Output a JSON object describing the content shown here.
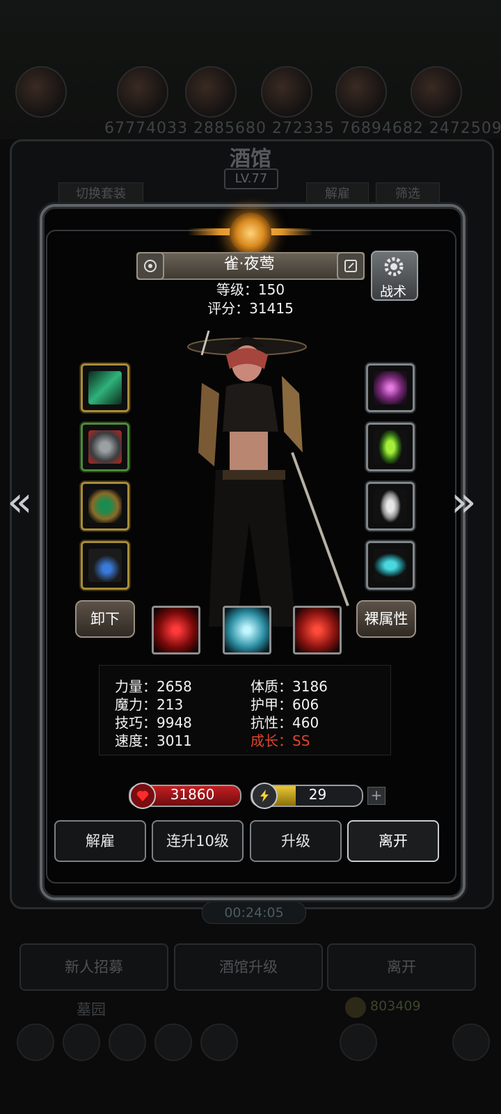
{
  "background": {
    "numbers_text": "67774033 2885680  272335  76894682 2472509",
    "title": "酒馆",
    "level": "LV.77",
    "tab_switch_set": "切换套装",
    "tab_dismiss": "解雇",
    "tab_filter": "筛选",
    "timer": "00:24:05",
    "buttons": [
      "新人招募",
      "酒馆升级",
      "离开"
    ],
    "graveyard": "墓园",
    "gold": "803409"
  },
  "hero": {
    "name": "雀·夜莺",
    "level_text": "等级：150",
    "score_text": "评分：31415"
  },
  "tactics_label": "战术",
  "unequip_label": "卸下",
  "raw_attributes_label": "裸属性",
  "equipment_left": [
    "blade-weapon",
    "spiked-armor",
    "emerald-ring",
    "pendant-necklace"
  ],
  "equipment_right": [
    "purple-aura",
    "green-crystal",
    "chain-mail",
    "cyan-gem"
  ],
  "skills": [
    "red-slash",
    "cyan-whirl",
    "red-blade"
  ],
  "stats": {
    "strength": "力量：2658",
    "magic": "魔力：213",
    "skill": "技巧：9948",
    "speed": "速度：3011",
    "constitution": "体质：3186",
    "armor": "护甲：606",
    "resistance": "抗性：460",
    "growth": "成长：SS"
  },
  "hp": "31860",
  "energy": "29",
  "energy_fill_fraction": 0.4,
  "actions": {
    "dismiss": "解雇",
    "level_up_10": "连升10级",
    "level_up": "升级",
    "leave": "离开"
  },
  "colors": {
    "growth": "#e0432c",
    "hp": "#c51f22",
    "energy": "#e8c83a",
    "emblem": "#d98a1f"
  }
}
